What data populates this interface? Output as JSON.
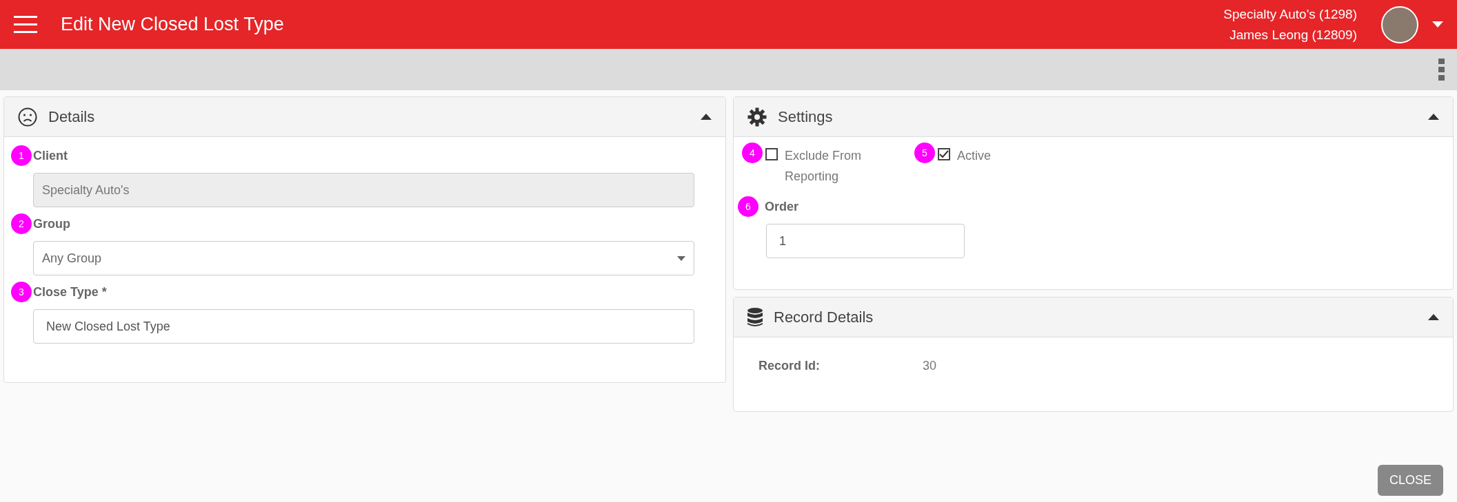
{
  "header": {
    "title": "Edit New Closed Lost Type",
    "account_lines": [
      "Specialty Auto's (1298)",
      "James Leong (12809)"
    ]
  },
  "details": {
    "title": "Details",
    "expanded": true,
    "fields": [
      {
        "badge": "1",
        "label": "Client",
        "kind": "readonly",
        "value": "Specialty Auto's"
      },
      {
        "badge": "2",
        "label": "Group",
        "kind": "select",
        "value": "Any Group"
      },
      {
        "badge": "3",
        "label": "Close Type *",
        "kind": "text",
        "value": "New Closed Lost Type"
      }
    ]
  },
  "settings": {
    "title": "Settings",
    "expanded": true,
    "checkboxes": [
      {
        "badge": "4",
        "label": "Exclude From Reporting",
        "checked": false
      },
      {
        "badge": "5",
        "label": "Active",
        "checked": true
      }
    ],
    "order": {
      "badge": "6",
      "label": "Order",
      "value": "1"
    }
  },
  "record_details": {
    "title": "Record Details",
    "expanded": true,
    "rows": [
      {
        "label": "Record Id:",
        "value": "30"
      }
    ]
  },
  "close_button": "CLOSE"
}
